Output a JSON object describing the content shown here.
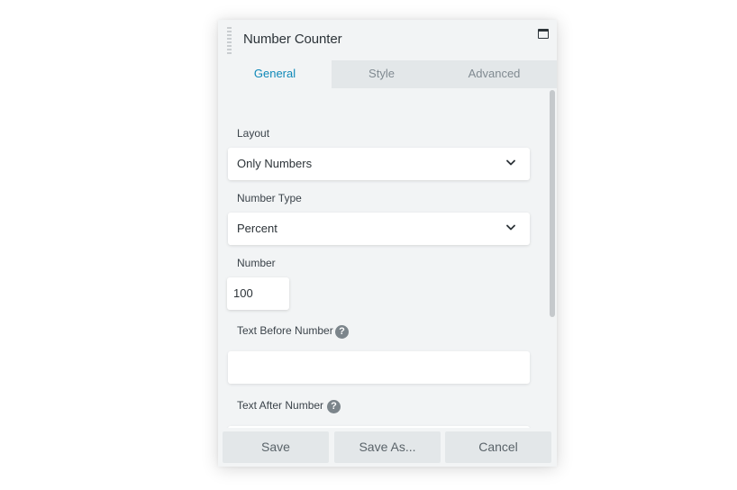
{
  "panel": {
    "title": "Number Counter",
    "maximize_icon": "maximize-icon"
  },
  "tabs": [
    {
      "label": "General",
      "active": true
    },
    {
      "label": "Style",
      "active": false
    },
    {
      "label": "Advanced",
      "active": false
    }
  ],
  "fields": {
    "layout": {
      "label": "Layout",
      "value": "Only Numbers"
    },
    "number_type": {
      "label": "Number Type",
      "value": "Percent"
    },
    "number": {
      "label": "Number",
      "value": "100"
    },
    "text_before": {
      "label": "Text Before Number",
      "value": "",
      "help_icon": "?"
    },
    "text_after": {
      "label": "Text After Number",
      "value": "",
      "help_icon": "?"
    }
  },
  "footer": {
    "save": "Save",
    "save_as": "Save As...",
    "cancel": "Cancel"
  },
  "colors": {
    "accent": "#0e88b8",
    "panel_bg": "#f2f4f5",
    "tab_bg": "#e3e7e9"
  }
}
